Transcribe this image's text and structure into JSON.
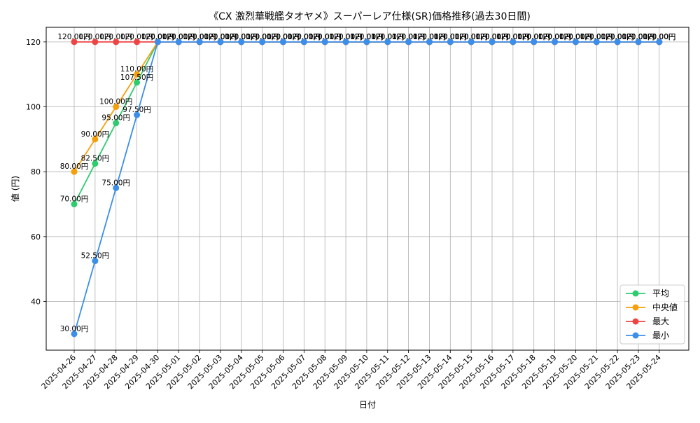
{
  "chart_data": {
    "type": "line",
    "title": "《CX 激烈華戦艦タオヤメ》スーパーレア仕様(SR)価格推移(過去30日間)",
    "xlabel": "日付",
    "ylabel": "値 (円)",
    "ylim": [
      25,
      124.5
    ],
    "yticks": [
      40,
      60,
      80,
      100,
      120
    ],
    "grid": true,
    "legend_position": "lower-right",
    "value_suffix": "円",
    "x": [
      "2025-04-26",
      "2025-04-27",
      "2025-04-28",
      "2025-04-29",
      "2025-04-30",
      "2025-05-01",
      "2025-05-02",
      "2025-05-03",
      "2025-05-04",
      "2025-05-05",
      "2025-05-06",
      "2025-05-07",
      "2025-05-08",
      "2025-05-09",
      "2025-05-10",
      "2025-05-11",
      "2025-05-12",
      "2025-05-13",
      "2025-05-14",
      "2025-05-15",
      "2025-05-16",
      "2025-05-17",
      "2025-05-18",
      "2025-05-19",
      "2025-05-20",
      "2025-05-21",
      "2025-05-22",
      "2025-05-23",
      "2025-05-24"
    ],
    "series": [
      {
        "name": "平均",
        "color": "#2ecc71",
        "values": [
          70,
          82.5,
          95,
          107.5,
          120,
          120,
          120,
          120,
          120,
          120,
          120,
          120,
          120,
          120,
          120,
          120,
          120,
          120,
          120,
          120,
          120,
          120,
          120,
          120,
          120,
          120,
          120,
          120,
          120
        ]
      },
      {
        "name": "中央値",
        "color": "#f5a00a",
        "values": [
          80,
          90,
          100,
          110,
          120,
          120,
          120,
          120,
          120,
          120,
          120,
          120,
          120,
          120,
          120,
          120,
          120,
          120,
          120,
          120,
          120,
          120,
          120,
          120,
          120,
          120,
          120,
          120,
          120
        ]
      },
      {
        "name": "最大",
        "color": "#ef4444",
        "values": [
          120,
          120,
          120,
          120,
          120,
          120,
          120,
          120,
          120,
          120,
          120,
          120,
          120,
          120,
          120,
          120,
          120,
          120,
          120,
          120,
          120,
          120,
          120,
          120,
          120,
          120,
          120,
          120,
          120
        ]
      },
      {
        "name": "最小",
        "color": "#3b8eea",
        "values": [
          30,
          52.5,
          75,
          97.5,
          120,
          120,
          120,
          120,
          120,
          120,
          120,
          120,
          120,
          120,
          120,
          120,
          120,
          120,
          120,
          120,
          120,
          120,
          120,
          120,
          120,
          120,
          120,
          120,
          120
        ]
      }
    ]
  }
}
